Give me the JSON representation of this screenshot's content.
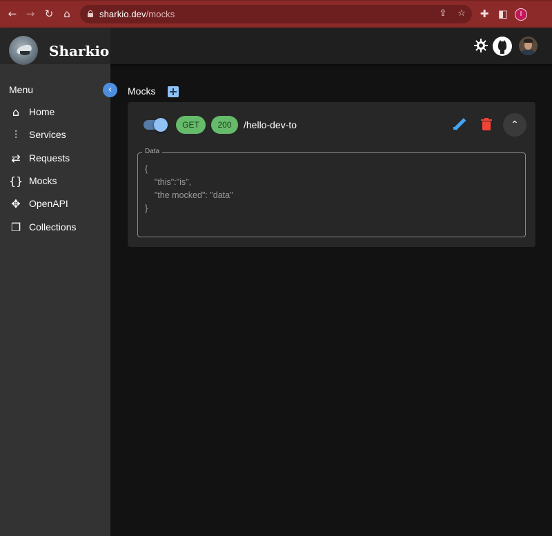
{
  "browser": {
    "url_host": "sharkio.dev",
    "url_path": "/mocks",
    "profile_initial": "I",
    "icons": [
      "back-arrow-icon",
      "forward-arrow-icon",
      "reload-icon",
      "home-icon",
      "lock-icon",
      "share-icon",
      "star-icon",
      "extensions-icon",
      "side-panel-icon"
    ],
    "accent_color": "#8c2a2a"
  },
  "app": {
    "brand": "Sharkio",
    "icons": [
      "theme-toggle-icon",
      "github-icon",
      "user-avatar"
    ]
  },
  "sidebar": {
    "title": "Menu",
    "items": [
      {
        "label": "Home",
        "icon": "home-icon"
      },
      {
        "label": "Services",
        "icon": "services-icon"
      },
      {
        "label": "Requests",
        "icon": "swap-arrows-icon"
      },
      {
        "label": "Mocks",
        "icon": "curly-braces-icon"
      },
      {
        "label": "OpenAPI",
        "icon": "api-icon"
      },
      {
        "label": "Collections",
        "icon": "collections-icon"
      }
    ]
  },
  "main": {
    "title": "Mocks",
    "mock": {
      "enabled": true,
      "method": "GET",
      "status": "200",
      "path": "/hello-dev-to",
      "data_label": "Data",
      "data_lines": [
        "{",
        "    \"this\":\"is\",",
        "    \"the mocked\": \"data\"",
        "}"
      ]
    },
    "colors": {
      "chip": "#66bb6a",
      "edit": "#42a5f5",
      "delete": "#f44336",
      "switch": "#90c1f5"
    }
  }
}
